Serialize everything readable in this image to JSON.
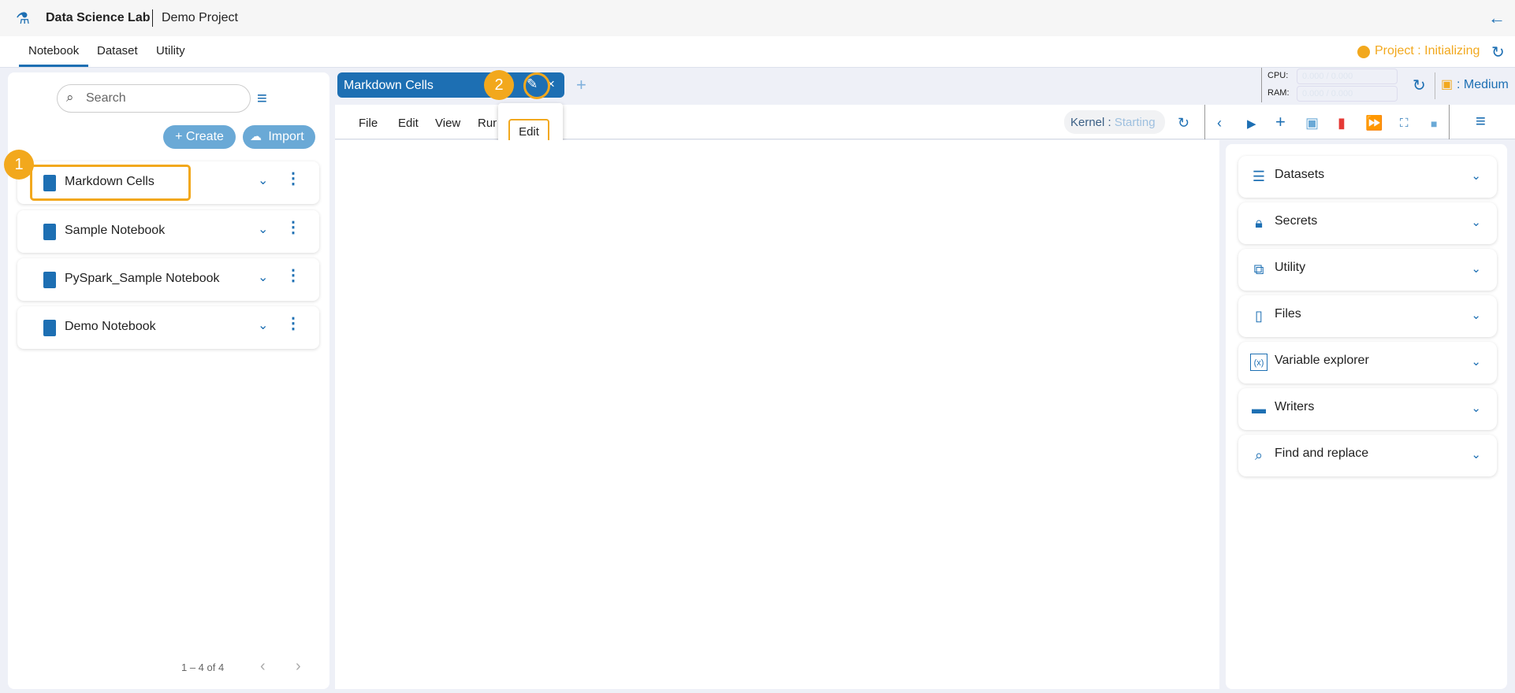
{
  "header": {
    "app_name": "Data Science Lab",
    "project": "Demo Project"
  },
  "nav_tabs": [
    "Notebook",
    "Dataset",
    "Utility"
  ],
  "project_status": "Project : Initializing",
  "left": {
    "search_placeholder": "Search",
    "create": "+ Create",
    "import": "Import",
    "notebooks": [
      "Markdown Cells",
      "Sample Notebook",
      "PySpark_Sample Notebook",
      "Demo Notebook"
    ],
    "pagination": "1 – 4 of 4"
  },
  "editor": {
    "tab": "Markdown Cells",
    "menu": [
      "File",
      "Edit",
      "View",
      "Run"
    ],
    "tooltip": "Edit",
    "kernel_label": "Kernel :",
    "kernel_status": "Starting",
    "cpu_label": "CPU:",
    "cpu_value": "0.000 / 0.000",
    "ram_label": "RAM:",
    "ram_value": "0.000 / 0.000",
    "size": ": Medium"
  },
  "right_panel": [
    "Datasets",
    "Secrets",
    "Utility",
    "Files",
    "Variable explorer",
    "Writers",
    "Find and replace"
  ],
  "annotations": [
    "1",
    "2"
  ],
  "colors": {
    "accent": "#1d6fb3",
    "annotation": "#f2a81d"
  }
}
